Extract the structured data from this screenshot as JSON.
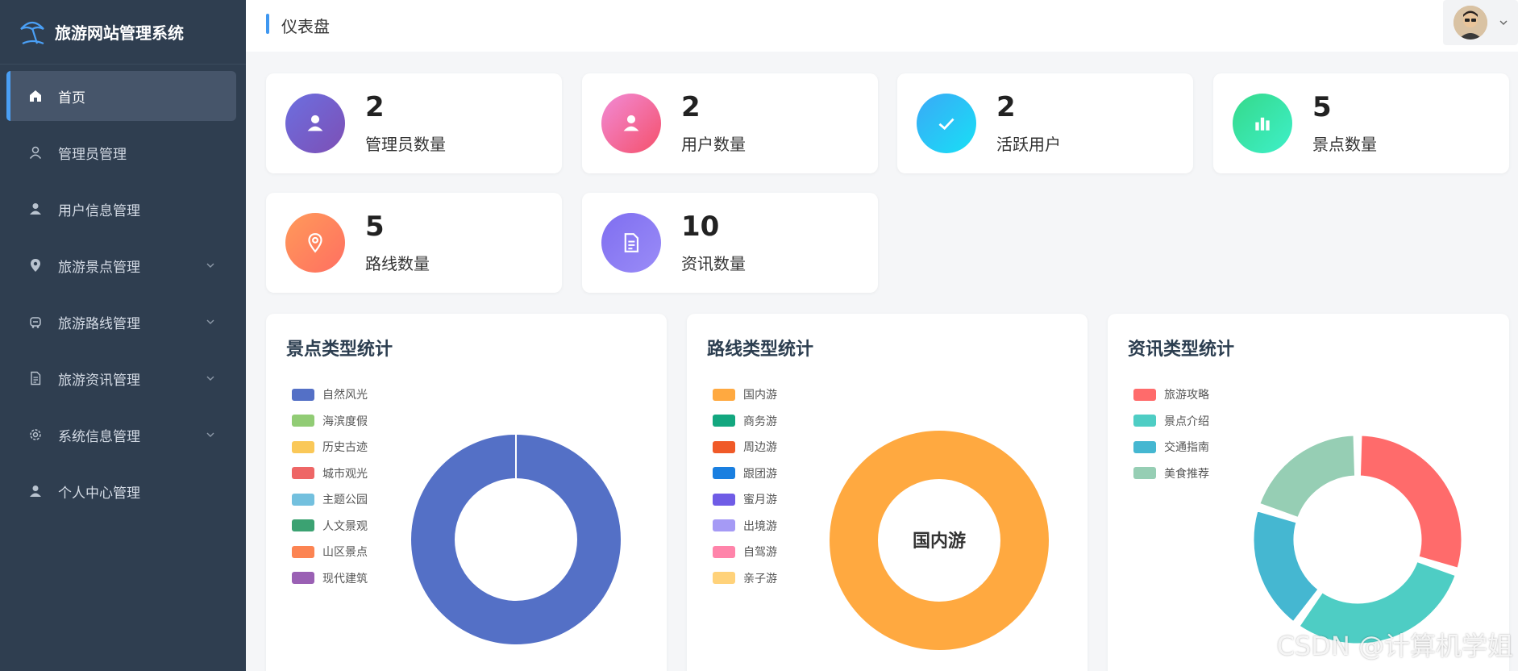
{
  "app": {
    "title": "旅游网站管理系统"
  },
  "sidebar": {
    "items": [
      {
        "label": "首页",
        "icon": "home-icon",
        "active": true,
        "has_submenu": false
      },
      {
        "label": "管理员管理",
        "icon": "user-outline-icon",
        "active": false,
        "has_submenu": false
      },
      {
        "label": "用户信息管理",
        "icon": "user-icon",
        "active": false,
        "has_submenu": false
      },
      {
        "label": "旅游景点管理",
        "icon": "location-icon",
        "active": false,
        "has_submenu": true
      },
      {
        "label": "旅游路线管理",
        "icon": "route-icon",
        "active": false,
        "has_submenu": true
      },
      {
        "label": "旅游资讯管理",
        "icon": "document-icon",
        "active": false,
        "has_submenu": true
      },
      {
        "label": "系统信息管理",
        "icon": "gear-icon",
        "active": false,
        "has_submenu": true
      },
      {
        "label": "个人中心管理",
        "icon": "person-icon",
        "active": false,
        "has_submenu": false
      }
    ]
  },
  "header": {
    "title": "仪表盘"
  },
  "stats": [
    {
      "value": "2",
      "label": "管理员数量",
      "icon": "user-icon",
      "color_from": "#6c6fe0",
      "color_to": "#7d4fb5"
    },
    {
      "value": "2",
      "label": "用户数量",
      "icon": "user-icon",
      "color_from": "#f28bd6",
      "color_to": "#f4506b"
    },
    {
      "value": "2",
      "label": "活跃用户",
      "icon": "check-icon",
      "color_from": "#3aa9f7",
      "color_to": "#18e0f5"
    },
    {
      "value": "5",
      "label": "景点数量",
      "icon": "bar-chart-icon",
      "color_from": "#35d98a",
      "color_to": "#3ef0c9"
    },
    {
      "value": "5",
      "label": "路线数量",
      "icon": "location-icon",
      "color_from": "#ff9a5a",
      "color_to": "#ff6f61"
    },
    {
      "value": "10",
      "label": "资讯数量",
      "icon": "document-icon",
      "color_from": "#7f6ef0",
      "color_to": "#9a8cf7"
    }
  ],
  "chart_data": [
    {
      "type": "pie",
      "title": "景点类型统计",
      "categories": [
        "自然风光",
        "海滨度假",
        "历史古迹",
        "城市观光",
        "主题公园",
        "人文景观",
        "山区景点",
        "现代建筑"
      ],
      "colors": [
        "#5470c6",
        "#91cc75",
        "#fac858",
        "#ee6666",
        "#73c0de",
        "#3ba272",
        "#fc8452",
        "#9a60b4"
      ],
      "values": [
        5,
        0,
        0,
        0,
        0,
        0,
        0,
        0
      ],
      "center_label": ""
    },
    {
      "type": "pie",
      "title": "路线类型统计",
      "categories": [
        "国内游",
        "商务游",
        "周边游",
        "跟团游",
        "蜜月游",
        "出境游",
        "自驾游",
        "亲子游"
      ],
      "colors": [
        "#ffa940",
        "#13a77f",
        "#f05a28",
        "#1a7fe0",
        "#6f5ce6",
        "#a59af5",
        "#ff84aa",
        "#ffd27a"
      ],
      "values": [
        5,
        0,
        0,
        0,
        0,
        0,
        0,
        0
      ],
      "center_label": "国内游"
    },
    {
      "type": "pie",
      "title": "资讯类型统计",
      "categories": [
        "旅游攻略",
        "景点介绍",
        "交通指南",
        "美食推荐"
      ],
      "colors": [
        "#ff6b6b",
        "#4ecdc4",
        "#45b7d1",
        "#96ceb4"
      ],
      "values": [
        3,
        3,
        2,
        2
      ],
      "center_label": ""
    }
  ],
  "watermark": "CSDN @计算机学姐"
}
